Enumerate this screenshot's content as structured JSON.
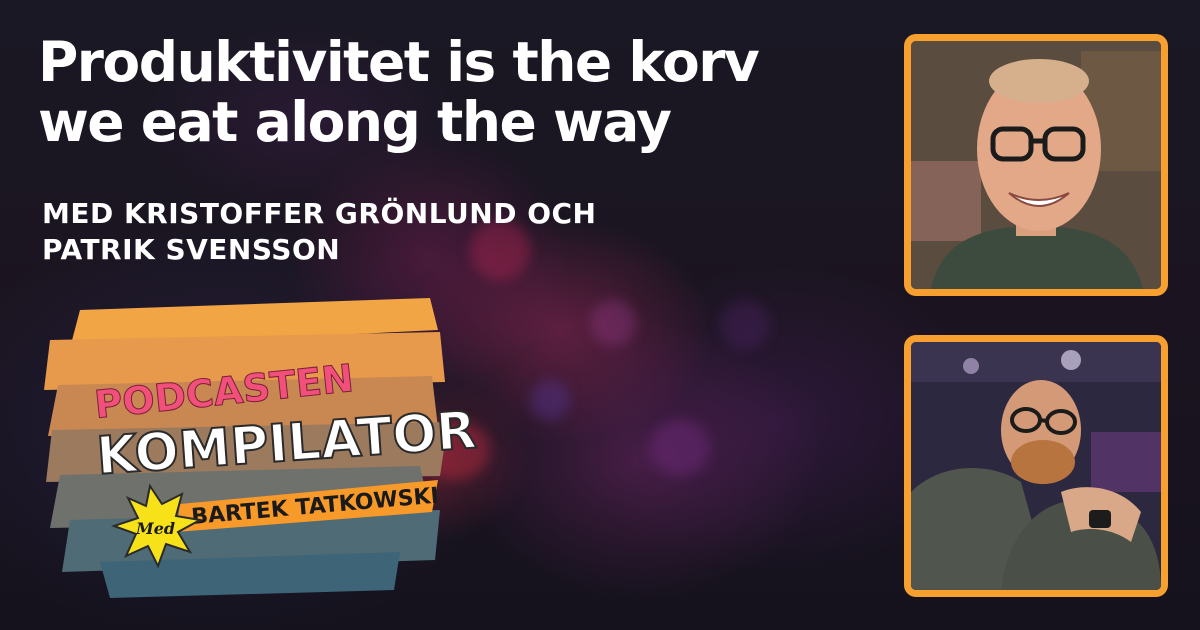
{
  "title": {
    "line1": "Produktivitet is the korv",
    "line2": "we eat along the way"
  },
  "subtitle": {
    "line1": "MED KRISTOFFER GRÖNLUND OCH",
    "line2": "PATRIK SVENSSON"
  },
  "logo": {
    "top_word": "PODCASTEN",
    "main_word": "KOMPILATOR",
    "med_label": "Med",
    "host_name": "BARTEK TATKOWSKI"
  },
  "colors": {
    "frame": "#f7a030",
    "podcasten_pink": "#f0507a",
    "banner_orange": "#f79a2a",
    "burst_yellow": "#f7e21a"
  }
}
